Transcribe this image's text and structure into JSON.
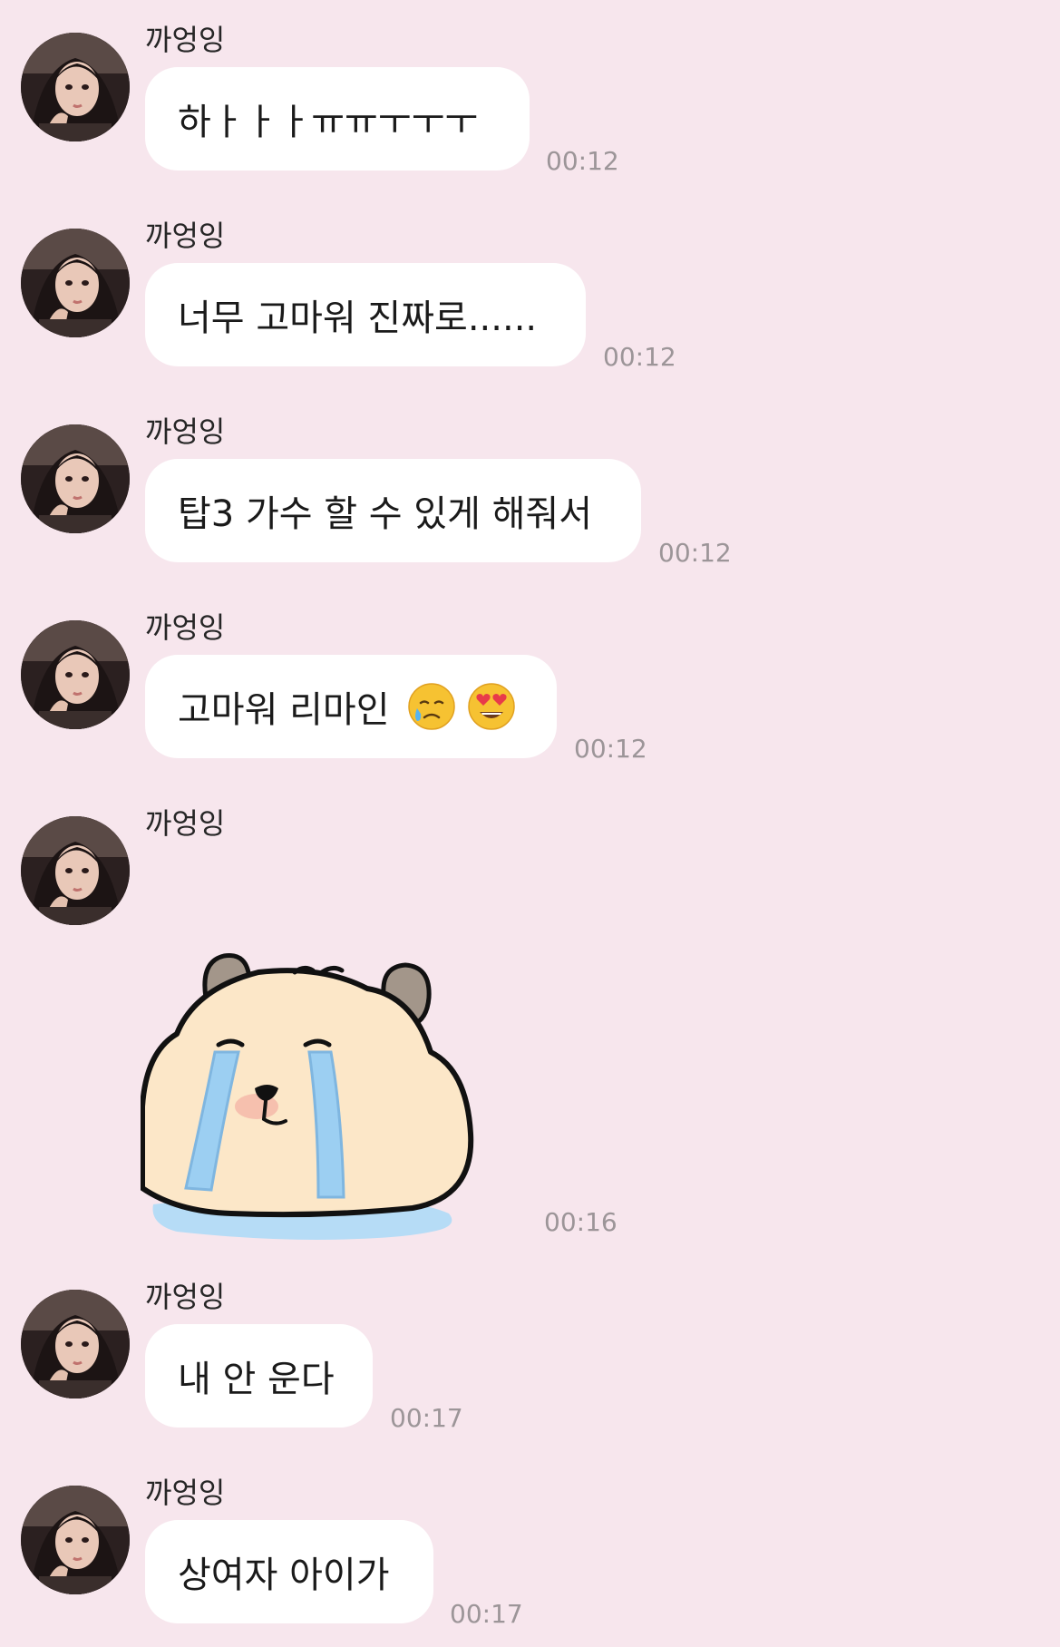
{
  "sender_name": "까엉잉",
  "messages": [
    {
      "type": "text",
      "text": "하ㅏㅏㅏㅠㅠㅜㅜㅜ",
      "time": "00:12"
    },
    {
      "type": "text",
      "text": "너무 고마워 진짜로......",
      "time": "00:12"
    },
    {
      "type": "text",
      "text": "탑3 가수 할 수 있게 해줘서",
      "time": "00:12"
    },
    {
      "type": "text",
      "text": "고마워 리마인",
      "emojis": [
        "face-holding-back-tears-icon",
        "heart-eyes-icon"
      ],
      "time": "00:12"
    },
    {
      "type": "sticker",
      "sticker": "crying-capybara-sticker",
      "time": "00:16"
    },
    {
      "type": "text",
      "text": "내 안 운다",
      "time": "00:17"
    },
    {
      "type": "text",
      "text": "상여자 아이가",
      "time": "00:17"
    }
  ],
  "colors": {
    "background": "#f7e6ed",
    "bubble": "#ffffff",
    "time": "#9c9598",
    "text": "#1a1a1a"
  }
}
